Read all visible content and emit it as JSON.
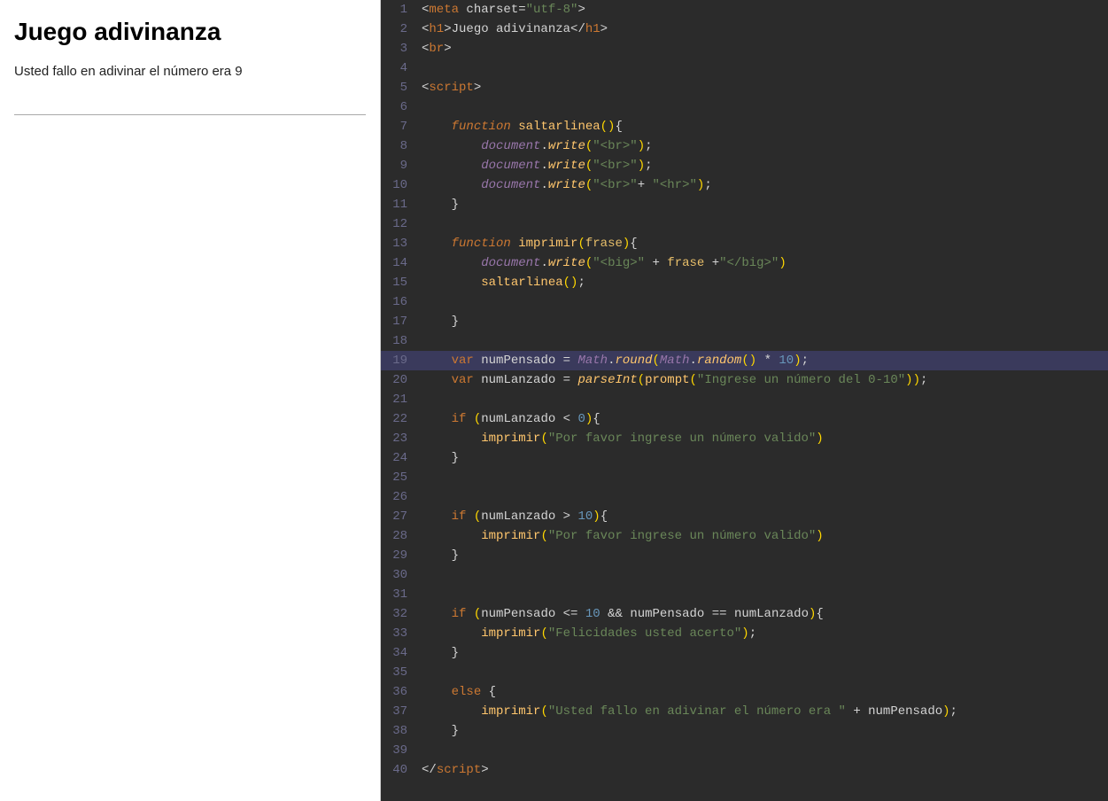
{
  "left": {
    "title": "Juego adivinanza",
    "body_text": "Usted fallo en adivinar el número era 9"
  },
  "editor": {
    "lines": [
      {
        "num": 1,
        "highlighted": false
      },
      {
        "num": 2,
        "highlighted": false
      },
      {
        "num": 3,
        "highlighted": false
      },
      {
        "num": 4,
        "highlighted": false
      },
      {
        "num": 5,
        "highlighted": false
      },
      {
        "num": 6,
        "highlighted": false
      },
      {
        "num": 7,
        "highlighted": false
      },
      {
        "num": 8,
        "highlighted": false
      },
      {
        "num": 9,
        "highlighted": false
      },
      {
        "num": 10,
        "highlighted": false
      },
      {
        "num": 11,
        "highlighted": false
      },
      {
        "num": 12,
        "highlighted": false
      },
      {
        "num": 13,
        "highlighted": false
      },
      {
        "num": 14,
        "highlighted": false
      },
      {
        "num": 15,
        "highlighted": false
      },
      {
        "num": 16,
        "highlighted": false
      },
      {
        "num": 17,
        "highlighted": false
      },
      {
        "num": 18,
        "highlighted": false
      },
      {
        "num": 19,
        "highlighted": true
      },
      {
        "num": 20,
        "highlighted": false
      },
      {
        "num": 21,
        "highlighted": false
      },
      {
        "num": 22,
        "highlighted": false
      },
      {
        "num": 23,
        "highlighted": false
      },
      {
        "num": 24,
        "highlighted": false
      },
      {
        "num": 25,
        "highlighted": false
      },
      {
        "num": 26,
        "highlighted": false
      },
      {
        "num": 27,
        "highlighted": false
      },
      {
        "num": 28,
        "highlighted": false
      },
      {
        "num": 29,
        "highlighted": false
      },
      {
        "num": 30,
        "highlighted": false
      },
      {
        "num": 31,
        "highlighted": false
      },
      {
        "num": 32,
        "highlighted": false
      },
      {
        "num": 33,
        "highlighted": false
      },
      {
        "num": 34,
        "highlighted": false
      },
      {
        "num": 35,
        "highlighted": false
      },
      {
        "num": 36,
        "highlighted": false
      },
      {
        "num": 37,
        "highlighted": false
      },
      {
        "num": 38,
        "highlighted": false
      },
      {
        "num": 39,
        "highlighted": false
      },
      {
        "num": 40,
        "highlighted": false
      }
    ]
  }
}
